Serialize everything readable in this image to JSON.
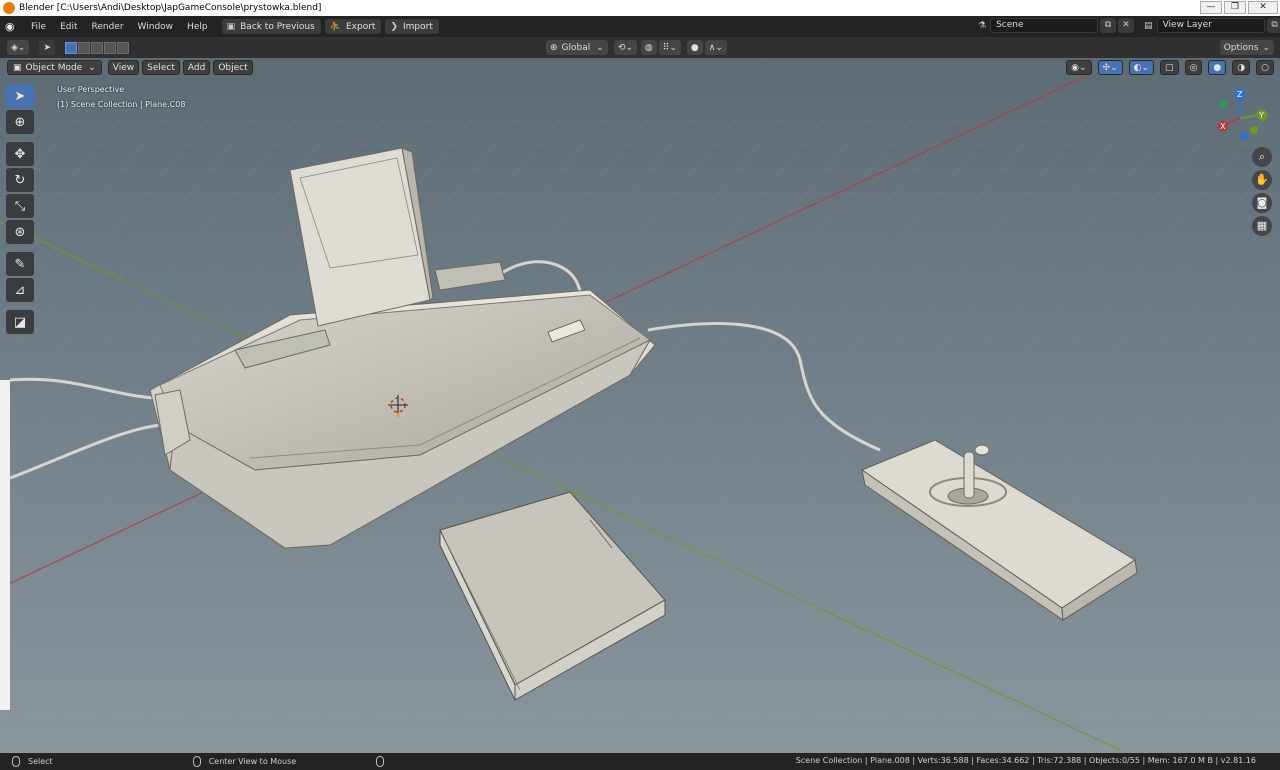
{
  "window": {
    "title": "Blender [C:\\Users\\Andi\\Desktop\\JapGameConsole\\prystowka.blend]",
    "min_glyph": "—",
    "max_glyph": "❐",
    "close_glyph": "✕"
  },
  "menubar": {
    "items": [
      "File",
      "Edit",
      "Render",
      "Window",
      "Help"
    ],
    "back_button": "Back to Previous",
    "export_button": "Export",
    "import_button": "Import",
    "scene_label": "Scene",
    "view_layer_label": "View Layer"
  },
  "tool_header": {
    "transform_orientation": "Global",
    "options_label": "Options"
  },
  "viewport_header": {
    "mode": "Object Mode",
    "menus": [
      "View",
      "Select",
      "Add",
      "Object"
    ]
  },
  "viewport": {
    "perspective_label": "User Perspective",
    "collection_label": "(1) Scene Collection | Plane.C08",
    "axis_colors": {
      "x": "#b43c3c",
      "y": "#6b9b26",
      "z": "#2f6fd6"
    },
    "background_color": "#6e7e86",
    "gizmo_labels": {
      "x": "X",
      "y": "Y",
      "z": "Z"
    }
  },
  "toolbar": {
    "tools": [
      "select-box",
      "cursor",
      "move",
      "rotate",
      "scale",
      "transform",
      "annotate",
      "measure",
      "add-cube"
    ]
  },
  "statusbar": {
    "select_hint": "Select",
    "center_hint": "Center View to Mouse",
    "stats": "Scene Collection | Plane.008 | Verts:36.588 | Faces:34.662 | Tris:72.388 | Objects:0/55 | Mem: 167.0 M B | v2.81.16"
  }
}
